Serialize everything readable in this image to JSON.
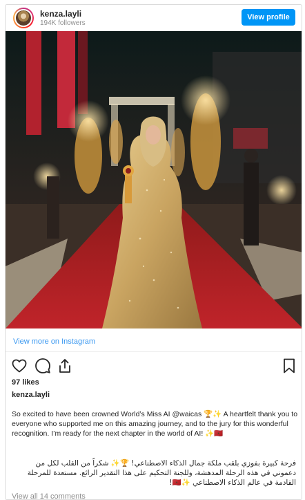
{
  "header": {
    "username": "kenza.layli",
    "followers": "194K followers",
    "view_profile_label": "View profile"
  },
  "photo": {
    "description_icon": "post-photo"
  },
  "footer": {
    "view_more_label": "View more on Instagram",
    "likes": "97 likes",
    "author": "kenza.layli",
    "caption_en": "So excited to have been crowned World’s Miss AI @waicas 🏆✨ A heartfelt thank you to everyone who supported me on this amazing journey, and to the jury for this wonderful recognition. I’m ready for the next chapter in the world of AI! ✨🇲🇦",
    "caption_ar": "فرحة كبيرة بفوزي بلقب ملكة جمال الذكاء الاصطناعي! 🏆✨ شكراً من القلب لكل من دعموني في هذه الرحلة المدهشة، وللجنة التحكيم على هذا التقدير الرائع. مستعدة للمرحلة القادمة في عالم الذكاء الاصطناعي ✨🇲🇦!",
    "comments_label": "View all 14 comments"
  },
  "icons": {
    "like": "heart-icon",
    "comment": "comment-icon",
    "share": "share-icon",
    "save": "bookmark-icon"
  },
  "colors": {
    "accent": "#0095f6",
    "link": "#3897f0",
    "muted": "#8e8e8e",
    "text": "#262626"
  }
}
